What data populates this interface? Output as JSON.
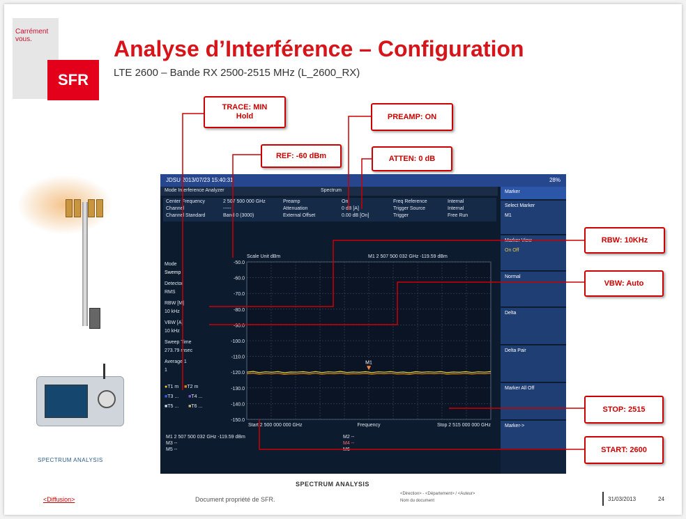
{
  "slide": {
    "brand_tag": "Carrément vous.",
    "logo": "SFR",
    "title": "Analyse d’Interférence – Configuration",
    "subtitle": "LTE 2600 – Bande RX 2500-2515 MHz (L_2600_RX)"
  },
  "callouts": {
    "trace": "TRACE: MIN\nHold",
    "preamp": "PREAMP: ON",
    "ref": "REF: -60 dBm",
    "atten": "ATTEN: 0 dB",
    "rbw": "RBW: 10KHz",
    "vbw": "VBW: Auto",
    "stop": "STOP: 2515",
    "start": "START: 2600"
  },
  "screen": {
    "status": "JDSU  2013/07/23 15:40:31",
    "battery": "28%",
    "mode": "Mode  Interference Analyzer",
    "mode_tab": "Spectrum",
    "info": {
      "center_label": "Center Frequency",
      "center_value": "2 507 500 000 GHz",
      "channel_label": "Channel",
      "channel_value": "-----",
      "standard_label": "Channel Standard",
      "standard_value": "Band 0 (3000)",
      "preamp_label": "Preamp",
      "preamp_value": "On",
      "atten_label": "Attenuation",
      "atten_value": "0 dB  [A]",
      "offset_label": "External Offset",
      "offset_value": "0.00 dB  [On]",
      "freqref_label": "Freq Reference",
      "freqref_value": "Internal",
      "trigsrc_label": "Trigger Source",
      "trigsrc_value": "Internal",
      "trigger_label": "Trigger",
      "trigger_value": "Free Run"
    },
    "scale_unit": "Scale Unit  dBm",
    "marker_readout": "M1  2 507 500 032 GHz  -119.59 dBm",
    "left_panel": [
      "Mode",
      "Swemp",
      "Detector",
      "RMS",
      "RBW [M]",
      "10 kHz",
      "VBW [A]",
      "10 kHz",
      "Sweep Time",
      "273.79 msec",
      "Average   1",
      "1"
    ],
    "traces": [
      "T1 m",
      "T2 m",
      "T3 ...",
      "T4 ...",
      "T5 ...",
      "T6 ..."
    ],
    "marker_label": "M1",
    "bottom": {
      "m1": "M1  2 507 500 032 GHz  -119.59 dBm",
      "m2": "M2  --",
      "m3": "M3  --",
      "m4": "M4  --",
      "m5": "M5  --",
      "m6": "M6  --"
    },
    "side_menu": [
      {
        "label": "Marker",
        "sub": ""
      },
      {
        "label": "Select Marker",
        "sub": "M1"
      },
      {
        "label": "Marker View",
        "sub": "On          Off"
      },
      {
        "label": "Normal",
        "sub": ""
      },
      {
        "label": "Delta",
        "sub": ""
      },
      {
        "label": "Delta Pair",
        "sub": ""
      },
      {
        "label": "Marker All Off",
        "sub": ""
      },
      {
        "label": "Marker->",
        "sub": ""
      }
    ]
  },
  "chart_data": {
    "type": "line",
    "title": "",
    "xlabel": "Frequency",
    "ylabel": "",
    "start_label": "Start  2 500 000 000 GHz",
    "stop_label": "Stop  2 515 000 000 GHz",
    "x_range": [
      2500,
      2515
    ],
    "ylim": [
      -150,
      -50
    ],
    "y_ticks": [
      "-50.0",
      "-60.0",
      "-70.0",
      "-80.0",
      "-90.0",
      "-100.0",
      "-110.0",
      "-120.0",
      "-130.0",
      "-140.0",
      "-150.0"
    ],
    "grid": true,
    "series": [
      {
        "name": "T1",
        "color": "#e6d23a",
        "values": [
          -120,
          -119.5,
          -120.3,
          -119.8,
          -120.1,
          -119.6,
          -120.4,
          -119.9,
          -120.0,
          -119.7,
          -120.2,
          -119.6,
          -120.3,
          -119.8,
          -120.0,
          -119.5,
          -120.2,
          -119.9,
          -120.1,
          -119.7,
          -120.3,
          -119.8,
          -120.0,
          -119.6,
          -120.2,
          -119.9,
          -120.4,
          -119.7,
          -120.1,
          -119.8,
          -120.0,
          -119.6,
          -120.3,
          -119.9,
          -120.1,
          -119.7,
          -120.2,
          -119.8,
          -120.0,
          -119.6
        ]
      },
      {
        "name": "T2",
        "color": "#d98a1f",
        "values": [
          -121,
          -120.6,
          -121.3,
          -120.9,
          -121.1,
          -120.7,
          -121.4,
          -121.0,
          -121.1,
          -120.8,
          -121.2,
          -120.7,
          -121.3,
          -120.9,
          -121.0,
          -120.6,
          -121.2,
          -121.0,
          -121.1,
          -120.8,
          -121.3,
          -120.9,
          -121.0,
          -120.7,
          -121.2,
          -121.0,
          -121.4,
          -120.8,
          -121.1,
          -120.9,
          -121.0,
          -120.7,
          -121.3,
          -121.0,
          -121.1,
          -120.8,
          -121.2,
          -120.9,
          -121.0,
          -120.7
        ]
      }
    ],
    "marker": {
      "name": "M1",
      "x": 2507.5,
      "y": -119.59
    }
  },
  "footer": {
    "caption": "SPECTRUM ANALYSIS",
    "diffusion": "<Diffusion>",
    "document": "Document propriété de SFR.",
    "direction": "<Direction> - <Département> / <Auteur>",
    "doc_name": "Nom du document",
    "date": "31/03/2013",
    "page": "24"
  },
  "left_images": {
    "device_label": "SPECTRUM ANALYSIS"
  }
}
